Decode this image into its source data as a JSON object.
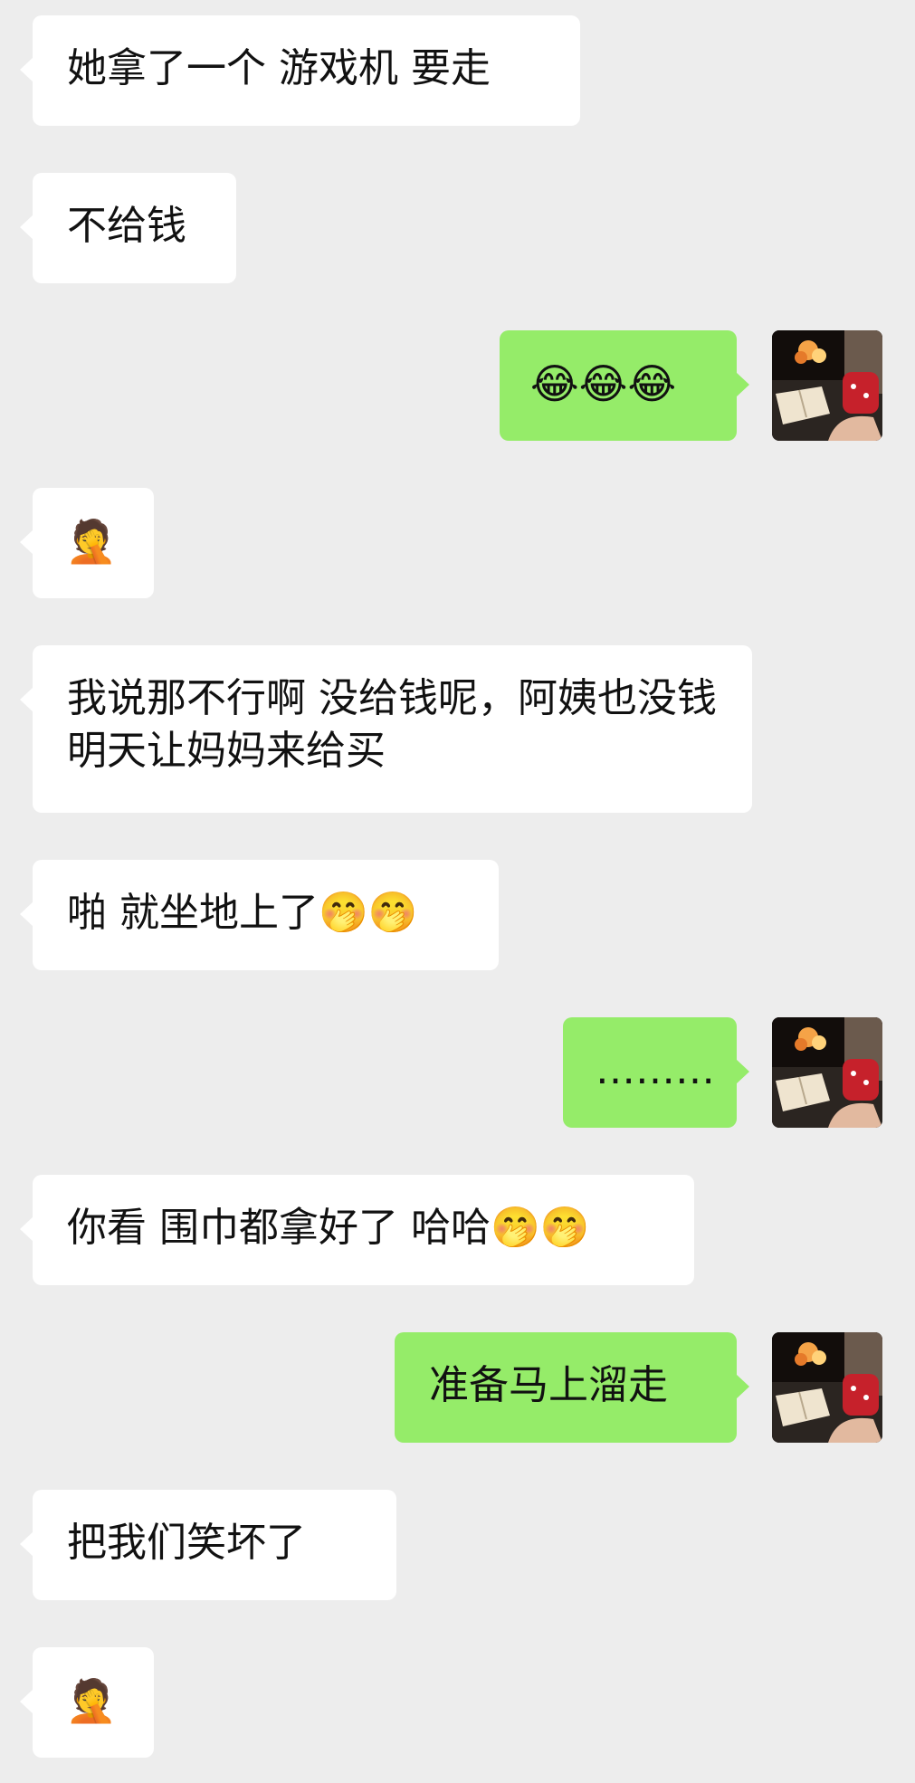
{
  "messages": [
    {
      "side": "left",
      "text": "她拿了一个 游戏机 要走"
    },
    {
      "side": "left",
      "text": "不给钱"
    },
    {
      "side": "right",
      "text": "😂😂😂"
    },
    {
      "side": "left",
      "text": "🤦"
    },
    {
      "side": "left",
      "text": "我说那不行啊 没给钱呢，阿姨也没钱 明天让妈妈来给买"
    },
    {
      "side": "left",
      "text": "啪 就坐地上了🤭🤭"
    },
    {
      "side": "right",
      "text": "………"
    },
    {
      "side": "left",
      "text": "你看 围巾都拿好了 哈哈🤭🤭"
    },
    {
      "side": "right",
      "text": "准备马上溜走"
    },
    {
      "side": "left",
      "text": "把我们笑坏了"
    },
    {
      "side": "left",
      "text": "🤦"
    }
  ],
  "avatar": {
    "icon": "avatar-book-coffee-fireplace"
  },
  "colors": {
    "background": "#ededed",
    "incoming": "#ffffff",
    "outgoing": "#95ec69"
  }
}
